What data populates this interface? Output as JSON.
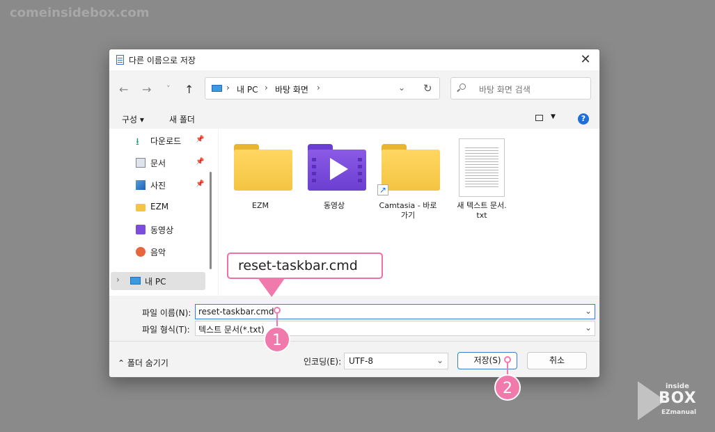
{
  "watermark": "comeinsidebox.com",
  "dialog": {
    "title": "다른 이름으로 저장",
    "close_glyph": "✕"
  },
  "nav": {
    "back": "←",
    "forward": "→",
    "recent": "˅",
    "up": "↑",
    "breadcrumb": [
      "내 PC",
      "바탕 화면"
    ],
    "sep": "›",
    "dropdown": "⌄",
    "refresh": "↻",
    "search_placeholder": "바탕 화면 검색"
  },
  "toolbar": {
    "organize": "구성 ▾",
    "new_folder": "새 폴더",
    "view_caret": "▼",
    "help": "?"
  },
  "sidebar": {
    "items": [
      {
        "label": "다운로드",
        "icon": "download-icon",
        "pinned": true
      },
      {
        "label": "문서",
        "icon": "document-icon",
        "pinned": true
      },
      {
        "label": "사진",
        "icon": "pictures-icon",
        "pinned": true
      },
      {
        "label": "EZM",
        "icon": "folder-icon",
        "pinned": false
      },
      {
        "label": "동영상",
        "icon": "videos-icon",
        "pinned": false
      },
      {
        "label": "음악",
        "icon": "music-icon",
        "pinned": false
      }
    ],
    "pin_glyph": "📌",
    "mypc": {
      "chevron": "›",
      "label": "내 PC"
    }
  },
  "files": [
    {
      "name": "EZM",
      "type": "folder"
    },
    {
      "name": "동영상",
      "type": "video-folder"
    },
    {
      "name_line1": "Camtasia - 바로",
      "name_line2": "가기",
      "type": "shortcut-folder"
    },
    {
      "name_line1": "새 텍스트 문서.",
      "name_line2": "txt",
      "type": "text-file"
    }
  ],
  "shortcut_glyph": "↗",
  "form": {
    "filename_label": "파일 이름(N):",
    "filename_value": "reset-taskbar.cmd",
    "filetype_label": "파일 형식(T):",
    "filetype_value": "텍스트 문서(*.txt)",
    "dropdown_glyph": "⌄",
    "hide_folders": "⌃  폴더 숨기기",
    "encoding_label": "인코딩(E):",
    "encoding_value": "UTF-8",
    "save": "저장(S)",
    "cancel": "취소"
  },
  "annotation": {
    "callout_text": "reset-taskbar.cmd",
    "marker1": "1",
    "marker2": "2"
  },
  "logo": {
    "line1": "inside",
    "line2": "BOX",
    "line3": "EZmanual"
  },
  "colors": {
    "accent": "#3a7bd5",
    "annotation_pink": "#f07aac",
    "folder_yellow": "#f4c443",
    "video_purple": "#6b3fd1"
  }
}
